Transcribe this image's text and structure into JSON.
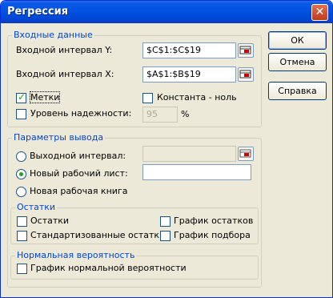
{
  "window": {
    "title": "Регрессия"
  },
  "input_group": {
    "legend": "Входные данные",
    "y_range_label": "Входной интервал Y:",
    "y_range_value": "$C$1:$C$19",
    "x_range_label": "Входной интервал X:",
    "x_range_value": "$A$1:$B$19",
    "labels_checkbox": "Метки",
    "labels_checked": true,
    "constant_zero_checkbox": "Константа - ноль",
    "constant_zero_checked": false,
    "confidence_checkbox": "Уровень надежности:",
    "confidence_checked": false,
    "confidence_value": "95",
    "percent_sign": "%"
  },
  "output_group": {
    "legend": "Параметры вывода",
    "output_range_radio": "Выходной интервал:",
    "output_range_value": "",
    "new_sheet_radio": "Новый рабочий лист:",
    "new_sheet_value": "",
    "new_workbook_radio": "Новая рабочая книга",
    "selected_option": "new_sheet"
  },
  "residuals_group": {
    "legend": "Остатки",
    "residuals": "Остатки",
    "standardized_residuals": "Стандартизованные остатки",
    "residual_plots": "График остатков",
    "line_fit_plots": "График подбора"
  },
  "normal_group": {
    "legend": "Нормальная вероятность",
    "normal_plot": "График нормальной вероятности"
  },
  "buttons": {
    "ok": "ОК",
    "cancel": "Отмена",
    "help": "Справка"
  },
  "icons": {
    "close": "close-icon",
    "range_select": "range-select-icon"
  },
  "colors": {
    "title_bar": "#0052e0",
    "legend_text": "#0046d5",
    "dialog_bg": "#ece9d8"
  }
}
